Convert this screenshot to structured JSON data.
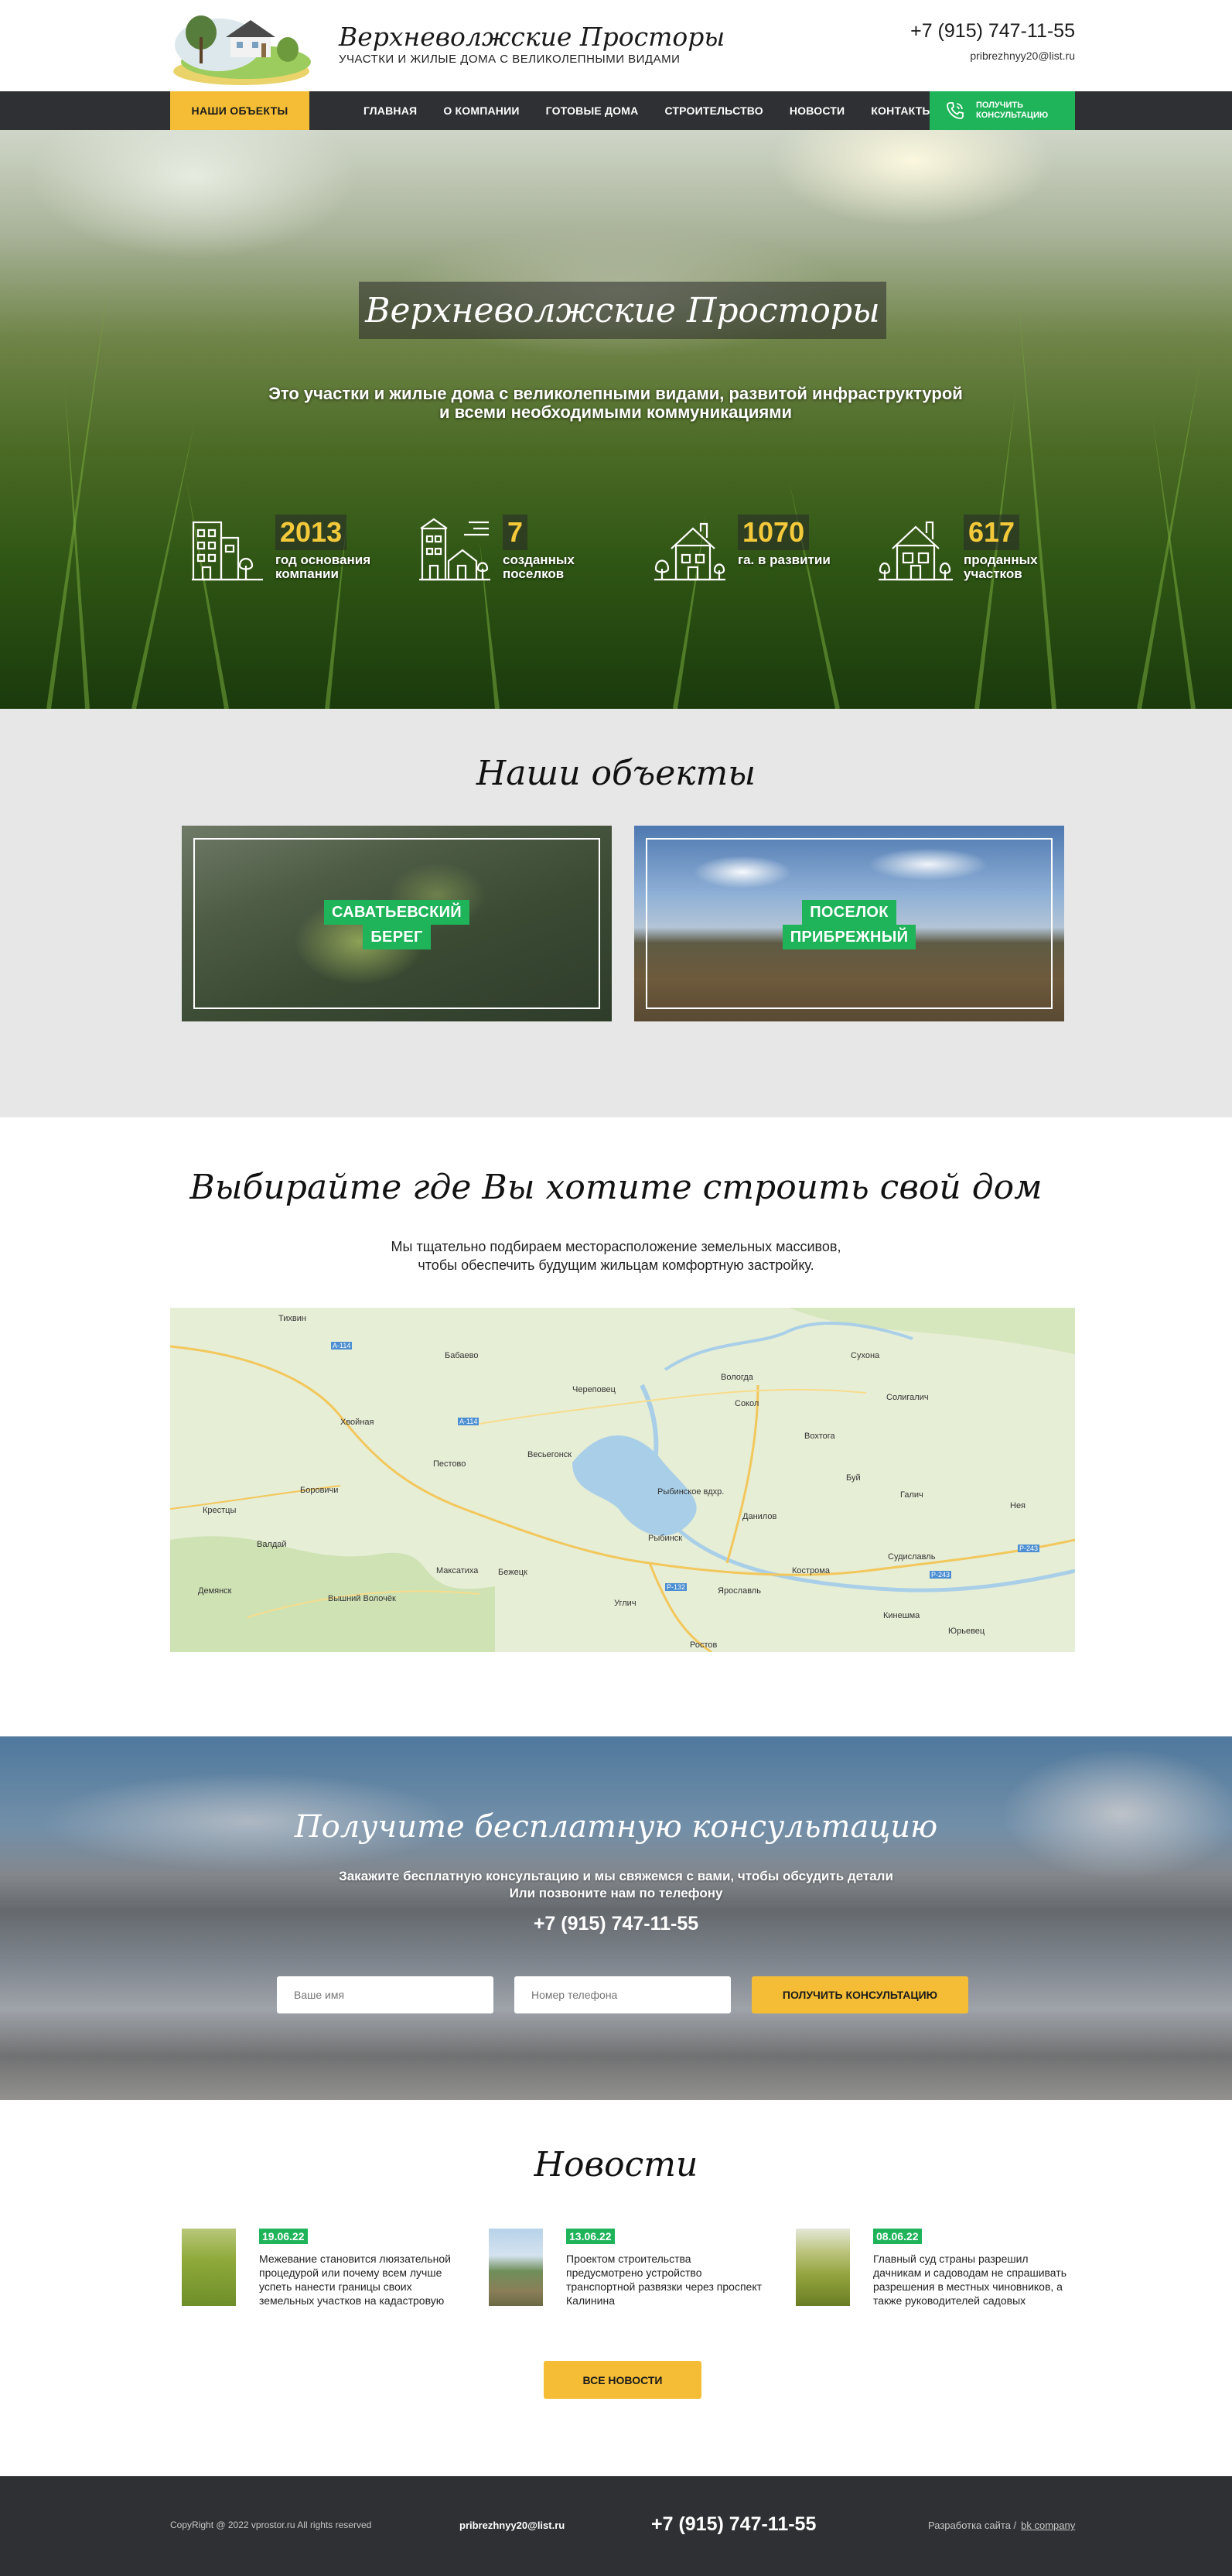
{
  "header": {
    "site_name": "Верхневолжские Просторы",
    "tagline": "УЧАСТКИ И ЖИЛЫЕ ДОМА С ВЕЛИКОЛЕПНЫМИ ВИДАМИ",
    "phone": "+7 (915) 747-11-55",
    "email": "pribrezhnyy20@list.ru"
  },
  "nav": {
    "objects_label": "НАШИ ОБЪЕКТЫ",
    "links": [
      "ГЛАВНАЯ",
      "О КОМПАНИИ",
      "ГОТОВЫЕ ДОМА",
      "СТРОИТЕЛЬСТВО",
      "НОВОСТИ",
      "КОНТАКТЫ"
    ],
    "consult_label": "ПОЛУЧИТЬ КОНСУЛЬТАЦИЮ"
  },
  "hero": {
    "title": "Верхневолжские Просторы",
    "subtitle_line1": "Это участки и жилые дома с великолепными видами, развитой инфраструктурой",
    "subtitle_line2": "и всеми необходимыми коммуникациями",
    "stats": [
      {
        "value": "2013",
        "label": "год основания компании",
        "icon": "office-building-icon"
      },
      {
        "value": "7",
        "label": "созданных поселков",
        "icon": "village-buildings-icon"
      },
      {
        "value": "1070",
        "label": "га. в развитии",
        "icon": "house-trees-icon"
      },
      {
        "value": "617",
        "label": "проданных участков",
        "icon": "house-sold-icon"
      }
    ]
  },
  "objects": {
    "title": "Наши объекты",
    "items": [
      {
        "line1": "САВАТЬЕВСКИЙ",
        "line2": "БЕРЕГ"
      },
      {
        "line1": "ПОСЕЛОК",
        "line2": "ПРИБРЕЖНЫЙ"
      }
    ]
  },
  "map_section": {
    "title": "Выбирайте где Вы хотите строить свой дом",
    "text_line1": "Мы тщательно подбираем месторасположение земельных массивов,",
    "text_line2": "чтобы обеспечить будущим жильцам комфортную застройку.",
    "labels": {
      "tikhvin": "Тихвин",
      "babaevo": "Бабаево",
      "cherepovets": "Череповец",
      "vologda": "Вологда",
      "sukhona": "Сухона",
      "sokol": "Сокол",
      "soligalich": "Солигалич",
      "khvoynaya": "Хвойная",
      "pestovo": "Пестово",
      "vesyegonsk": "Весьегонск",
      "vokhtoga": "Вохтога",
      "borovichi": "Боровичи",
      "kresttsy": "Крестцы",
      "rybinsk_res": "Рыбинское вдхр.",
      "danilov": "Данилов",
      "buy": "Буй",
      "galich": "Галич",
      "neya": "Нея",
      "valday": "Валдай",
      "rybinsk": "Рыбинск",
      "sudislavl": "Судиславль",
      "maksatikha": "Максатиха",
      "bezhetsk": "Бежецк",
      "kostroma": "Кострома",
      "demyansk": "Демянск",
      "vyshny_volochek": "Вышний Волочёк",
      "uglich": "Углич",
      "yaroslavl": "Ярославль",
      "kineshma": "Кинешма",
      "yurevets": "Юрьевец",
      "rostov": "Ростов",
      "a114": "А-114",
      "a114b": "А-114",
      "r132": "Р-132",
      "r243": "Р-243",
      "r243b": "Р-243"
    }
  },
  "consult": {
    "title": "Получите бесплатную консультацию",
    "text_line1": "Закажите бесплатную консультацию и мы свяжемся с вами, чтобы обсудить детали",
    "text_line2": "Или позвоните нам по телефону",
    "phone": "+7 (915) 747-11-55",
    "name_placeholder": "Ваше имя",
    "phone_placeholder": "Номер телефона",
    "button_label": "ПОЛУЧИТЬ КОНСУЛЬТАЦИЮ"
  },
  "news": {
    "title": "Новости",
    "items": [
      {
        "date": "19.06.22",
        "text": "Межевание становится люязательной процедурой или почему всем лучше успеть нанести границы своих земельных участков на кадастровую"
      },
      {
        "date": "13.06.22",
        "text": "Проектом строительства предусмотрено устройство транспортной развязки через проспект Калинина"
      },
      {
        "date": "08.06.22",
        "text": "Главный суд страны разрешил дачникам и садоводам не спрашивать разрешения в местных чиновников, а также руководителей садовых"
      }
    ],
    "button_label": "ВСЕ НОВОСТИ"
  },
  "footer": {
    "copyright": "CopyRight @ 2022 vprostor.ru All rights reserved",
    "email": "pribrezhnyy20@list.ru",
    "phone": "+7 (915) 747-11-55",
    "dev_label": "Разработка сайта /",
    "dev_link": "bk company"
  },
  "colors": {
    "accent_yellow": "#f4bd35",
    "accent_green": "#1fb45a",
    "dark": "#2f3033",
    "stat_value": "#f4c93a"
  }
}
